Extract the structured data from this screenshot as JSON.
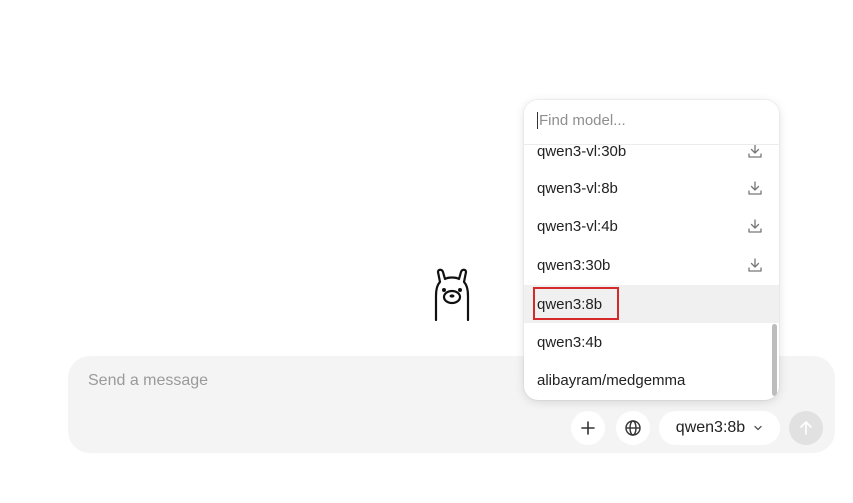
{
  "composer": {
    "placeholder": "Send a message",
    "model_label": "qwen3:8b"
  },
  "model_picker": {
    "search_placeholder": "Find model...",
    "items": [
      {
        "label": "qwen3-vl:30b",
        "downloadable": true
      },
      {
        "label": "qwen3-vl:8b",
        "downloadable": true
      },
      {
        "label": "qwen3-vl:4b",
        "downloadable": true
      },
      {
        "label": "qwen3:30b",
        "downloadable": true
      },
      {
        "label": "qwen3:8b",
        "downloadable": false,
        "selected": true
      },
      {
        "label": "qwen3:4b",
        "downloadable": false
      },
      {
        "label": "alibayram/medgemma",
        "downloadable": false
      }
    ]
  },
  "icons": {
    "logo": "llama-logo-icon",
    "add": "plus-icon",
    "web": "globe-icon",
    "dropdown": "chevron-down-icon",
    "send": "arrow-up-icon",
    "download": "download-icon"
  },
  "colors": {
    "highlight": "#d62a2a",
    "composer_bg": "#f4f4f4",
    "selected_bg": "#f0f0f0"
  }
}
